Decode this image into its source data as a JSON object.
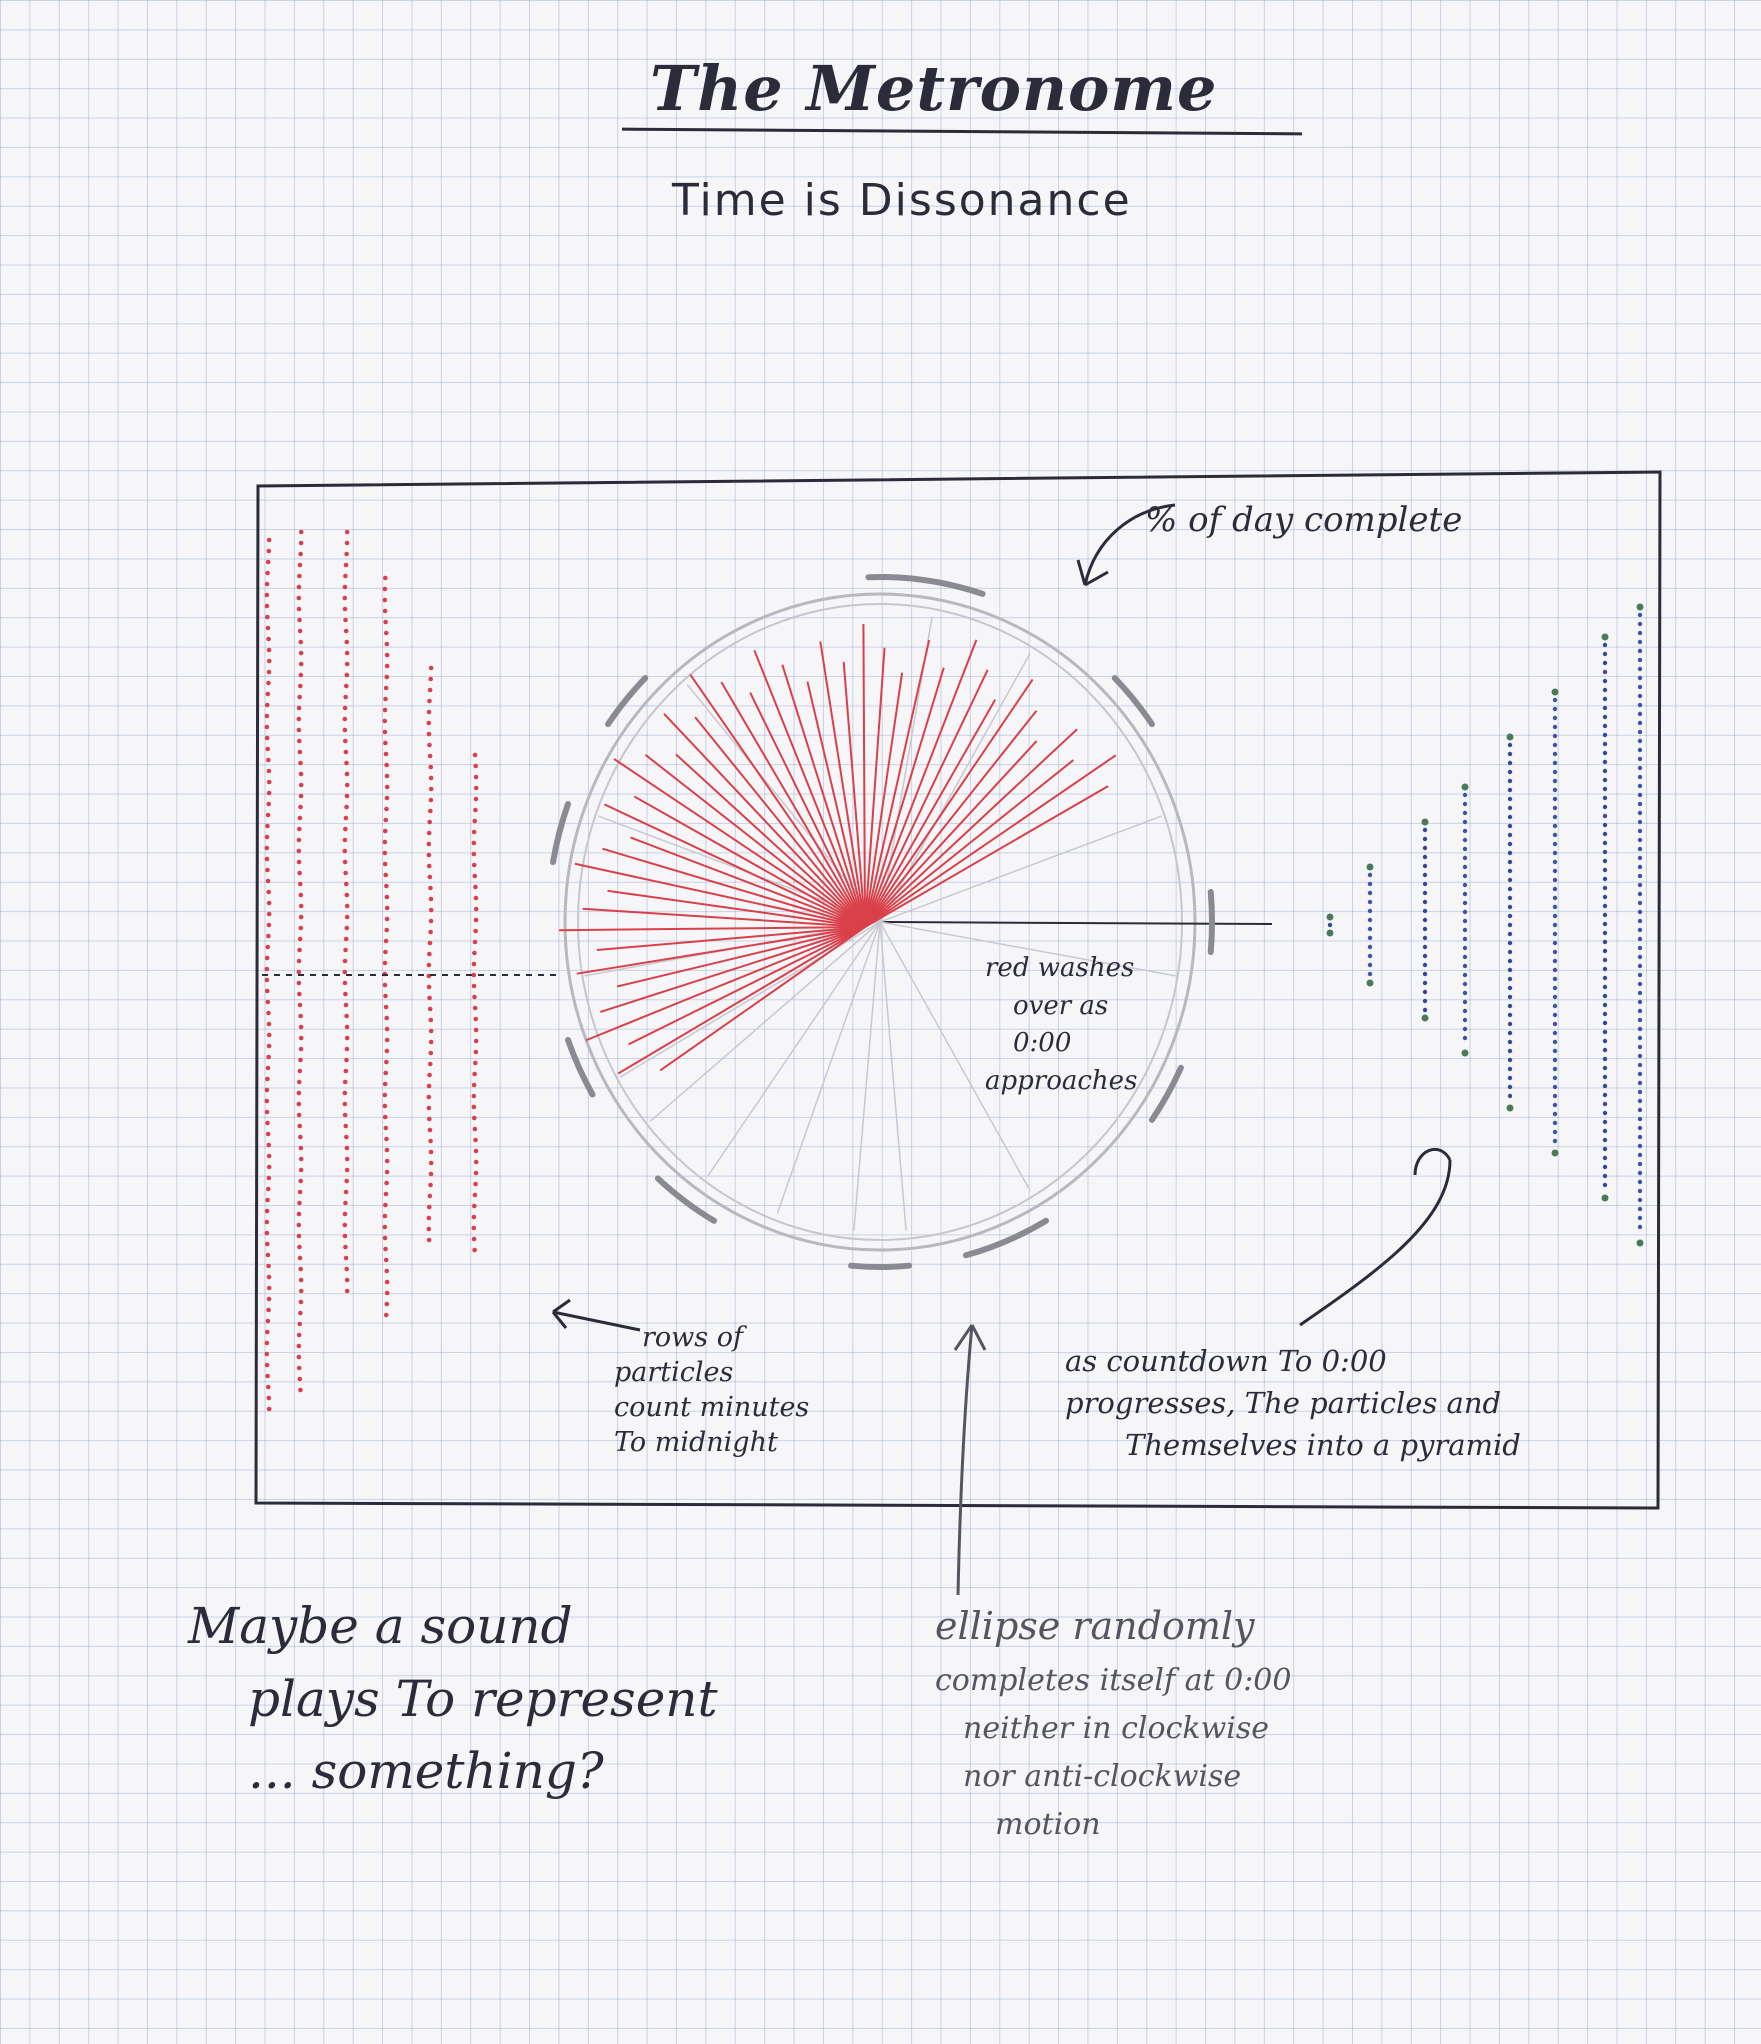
{
  "title": "The Metronome",
  "subtitle": "Time is Dissonance",
  "annotations": {
    "percent_day": "% of day complete",
    "red_washes": [
      "red washes",
      "over as",
      "0:00",
      "approaches"
    ],
    "rows": [
      "rows of",
      "particles",
      "count minutes",
      "To midnight"
    ],
    "countdown": [
      "as countdown To 0:00",
      "progresses, The particles and",
      "Themselves into a pyramid"
    ],
    "sound": [
      "Maybe a sound",
      "plays To represent",
      "... something?"
    ],
    "ellipse": [
      "ellipse randomly",
      "completes itself at 0:00",
      "neither in clockwise",
      "nor anti-clockwise",
      "motion"
    ]
  },
  "colors": {
    "ink": "#2b2b3a",
    "red": "#d9404a",
    "grey": "#9a9aa2",
    "blue": "#3a55a8",
    "green": "#4a7a5a"
  },
  "icons": {
    "arrow_to_ring": "curved-arrow-icon",
    "arrow_to_rows": "left-arrow-icon",
    "arrow_to_ellipse": "up-arrow-icon",
    "arrow_to_pyramid": "curved-arrow-icon"
  }
}
